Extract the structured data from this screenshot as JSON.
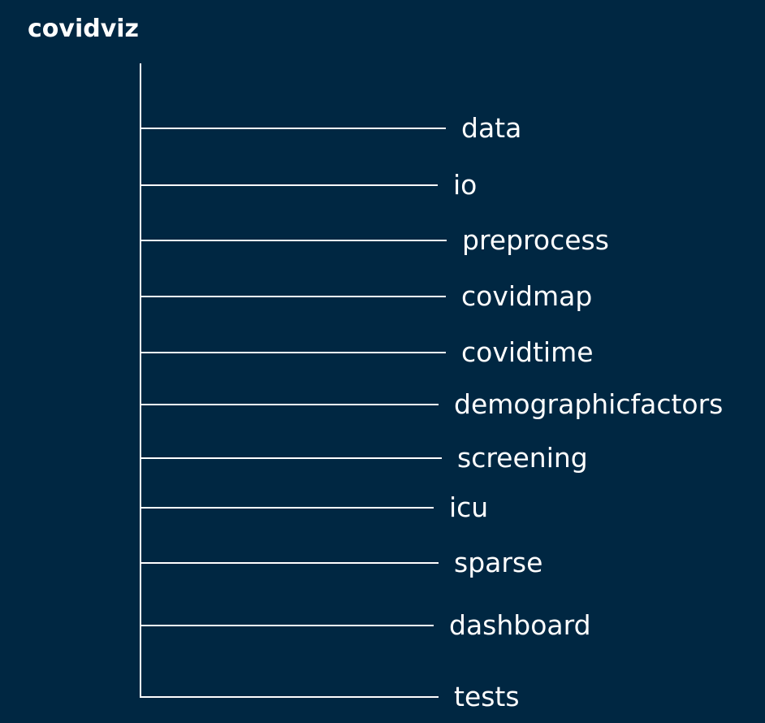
{
  "tree": {
    "root": "covidviz",
    "children": [
      "data",
      "io",
      "preprocess",
      "covidmap",
      "covidtime",
      "demographicfactors",
      "screening",
      "icu",
      "sparse",
      "dashboard",
      "tests"
    ]
  },
  "colors": {
    "background": "#002742",
    "line": "#ffffff",
    "text": "#ffffff"
  }
}
